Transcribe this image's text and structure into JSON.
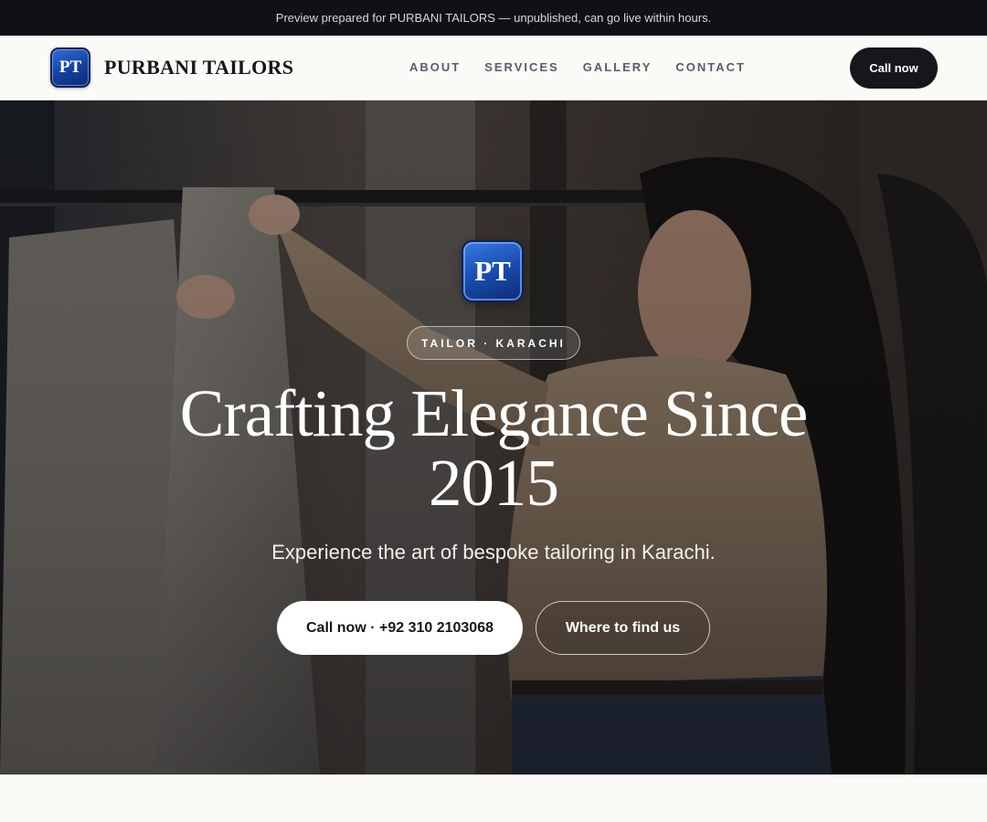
{
  "preview_bar": {
    "text": "Preview prepared for PURBANI TAILORS — unpublished, can go live within hours."
  },
  "header": {
    "logo_text": "PT",
    "brand_name": "PURBANI TAILORS",
    "nav": [
      {
        "label": "ABOUT"
      },
      {
        "label": "SERVICES"
      },
      {
        "label": "GALLERY"
      },
      {
        "label": "CONTACT"
      }
    ],
    "cta_label": "Call now"
  },
  "hero": {
    "logo_text": "PT",
    "tag": "TAILOR · KARACHI",
    "title_line1": "Crafting Elegance Since",
    "title_line2": "2015",
    "subtitle": "Experience the art of bespoke tailoring in Karachi.",
    "primary_button": "Call now · +92 310 2103068",
    "secondary_button": "Where to find us"
  },
  "colors": {
    "dark": "#15171c",
    "logo_blue": "#1a4cb0",
    "background": "#faf9f6"
  }
}
